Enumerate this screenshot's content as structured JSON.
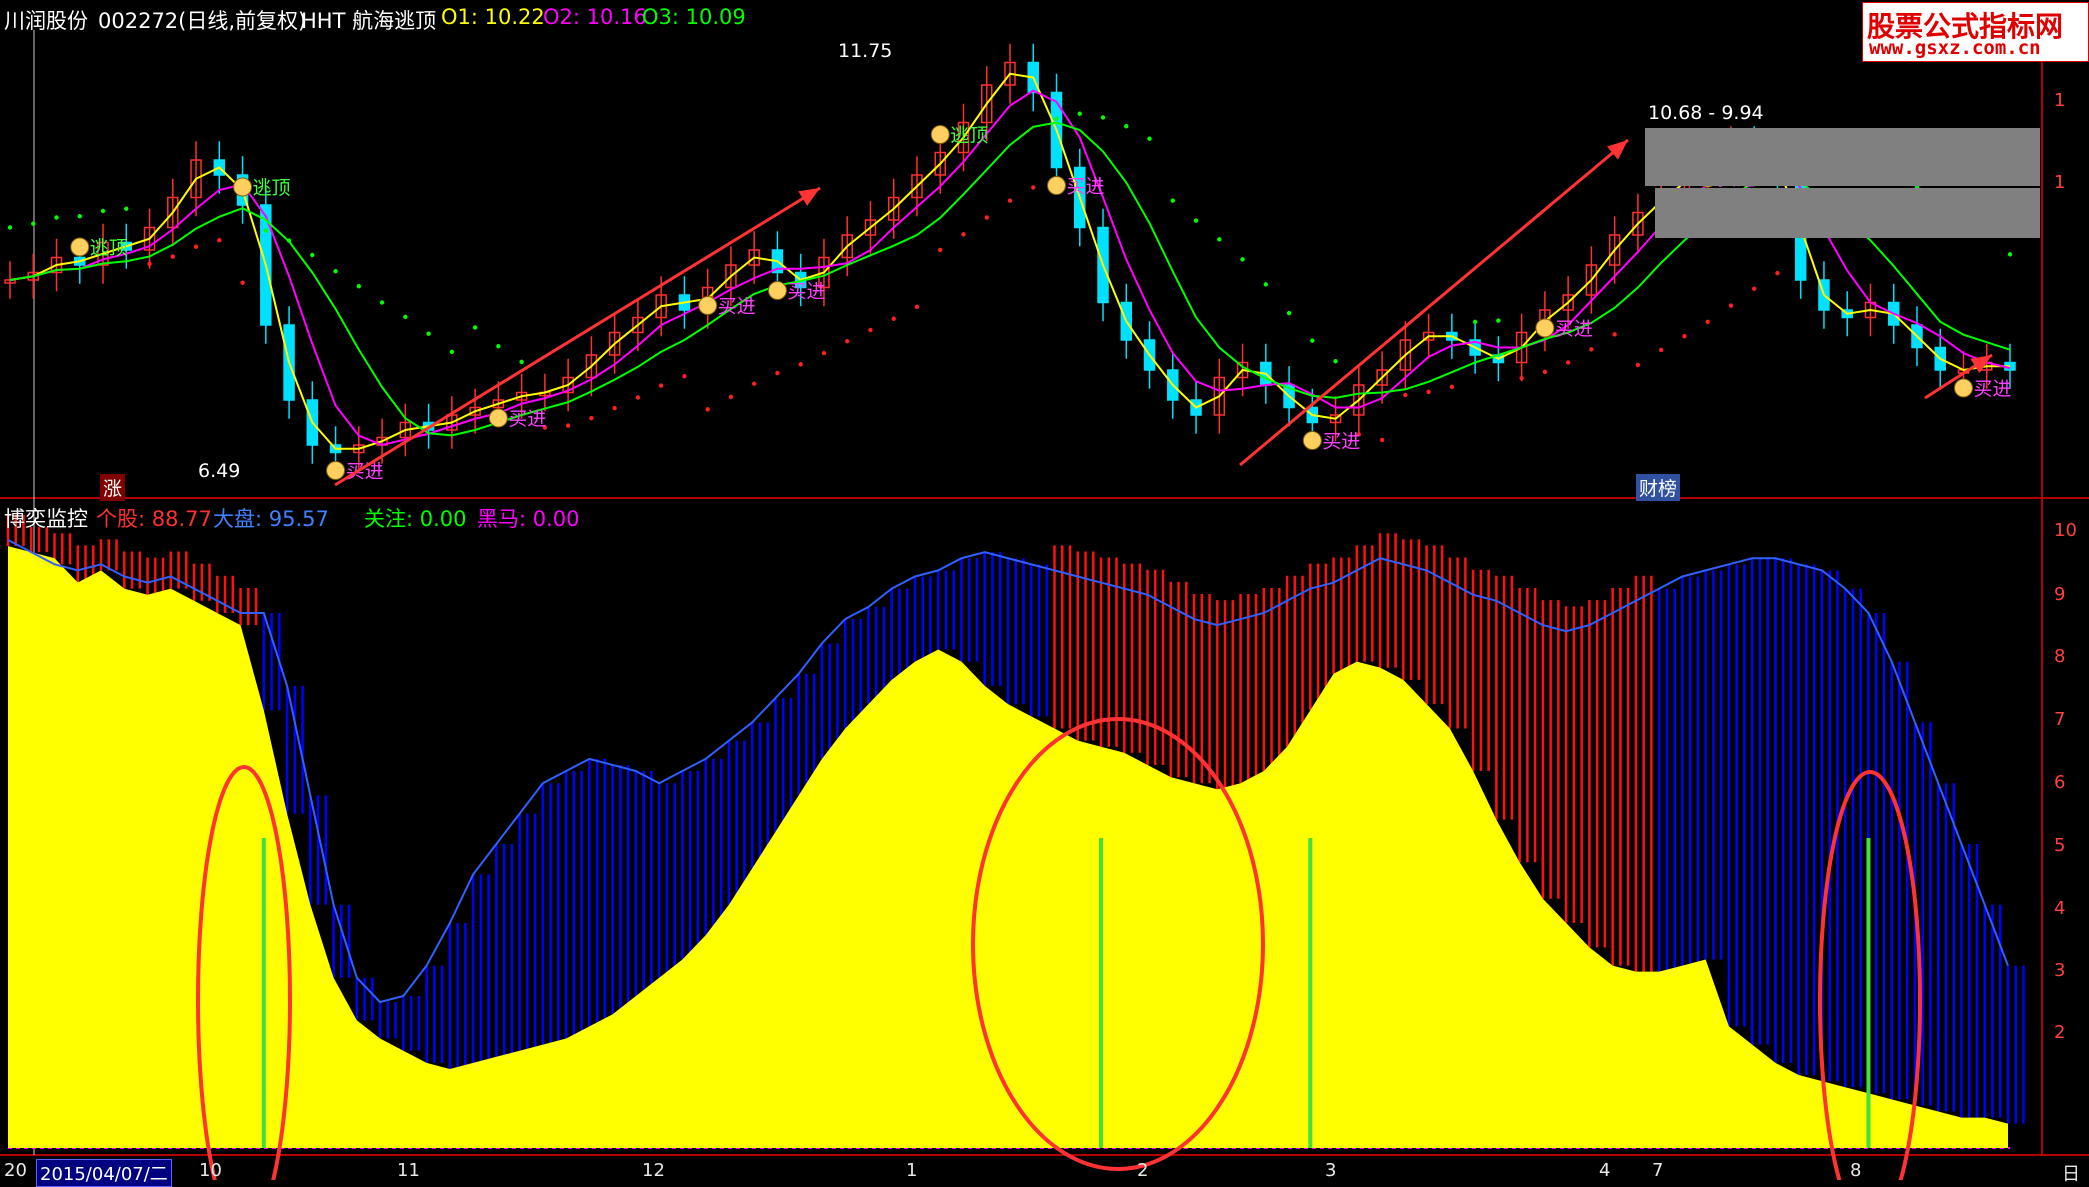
{
  "header": {
    "stock_name": "川润股份",
    "stock_code": "002272(日线,前复权)",
    "indicator_name": "HHT 航海逃顶",
    "o1_label": "O1: 10.22",
    "o2_label": "O2: 10.16",
    "o3_label": "O3: 10.09"
  },
  "watermark": {
    "title": "股票公式指标网",
    "url": "www.gsxz.com.cn"
  },
  "price_panel": {
    "high_label": "11.75",
    "low_label": "6.49",
    "range_label": "10.68 - 9.94",
    "top_label": "逃顶",
    "buy_label": "买进",
    "zhang_badge": "涨",
    "caibang_badge": "财榜"
  },
  "lower_panel": {
    "title": "博奕监控",
    "gegu_label": "个股: 88.77",
    "dapan_label": "大盘: 95.57",
    "guanzhu_label": "关注: 0.00",
    "heima_label": "黑马: 0.00",
    "y_ticks": [
      "10",
      "9",
      "8",
      "7",
      "6",
      "5",
      "4",
      "3",
      "2"
    ]
  },
  "price_y_ticks": [
    "1",
    "1",
    "",
    "",
    "",
    "",
    ""
  ],
  "x_axis": {
    "first_label": "20",
    "selected_date": "2015/04/07/二",
    "month_labels": [
      "10",
      "11",
      "12",
      "1",
      "2",
      "3",
      "4",
      "7",
      "8"
    ],
    "right_label": "日"
  },
  "colors": {
    "background": "#000000",
    "up": "#ff3030",
    "down": "#00e0ff",
    "ma_yellow": "#ffff00",
    "ma_magenta": "#ff00ff",
    "ma_green": "#00ff00",
    "gegu": "#ffff00",
    "dapan": "#0000ff",
    "red_bars": "#ff1010",
    "annotation_red": "#ff3333"
  },
  "chart_data": {
    "type": "line",
    "title": "川润股份 002272",
    "price_series": [
      8.8,
      8.9,
      9.1,
      9.0,
      9.3,
      9.2,
      9.5,
      9.9,
      10.4,
      10.2,
      9.8,
      8.2,
      7.2,
      6.6,
      6.5,
      6.6,
      6.7,
      6.9,
      6.8,
      7.0,
      7.1,
      7.2,
      7.3,
      7.3,
      7.5,
      7.8,
      8.1,
      8.3,
      8.6,
      8.4,
      8.7,
      9.0,
      9.2,
      8.9,
      8.7,
      9.1,
      9.4,
      9.6,
      9.9,
      10.2,
      10.5,
      10.9,
      11.4,
      11.7,
      11.3,
      10.3,
      9.5,
      8.5,
      8.0,
      7.6,
      7.2,
      7.0,
      7.5,
      7.7,
      7.4,
      7.1,
      6.9,
      7.0,
      7.4,
      7.6,
      8.0,
      8.1,
      8.0,
      7.8,
      7.7,
      8.1,
      8.4,
      8.6,
      9.0,
      9.4,
      9.7,
      10.0,
      10.2,
      10.4,
      10.6,
      10.5,
      10.2,
      8.8,
      8.4,
      8.3,
      8.5,
      8.2,
      7.9,
      7.6,
      7.6,
      7.7,
      7.6
    ],
    "series": [
      {
        "name": "个股",
        "values": [
          99,
          98,
          97,
          93,
          95,
          92,
          91,
          92,
          90,
          88,
          86,
          72,
          55,
          40,
          28,
          21,
          18,
          16,
          14,
          13,
          14,
          15,
          16,
          17,
          18,
          20,
          22,
          25,
          28,
          31,
          35,
          40,
          46,
          52,
          58,
          64,
          69,
          73,
          77,
          80,
          82,
          80,
          76,
          73,
          71,
          69,
          67,
          66,
          65,
          63,
          61,
          60,
          59,
          60,
          62,
          66,
          72,
          78,
          80,
          79,
          77,
          73,
          69,
          62,
          54,
          47,
          41,
          37,
          33,
          30,
          29,
          29,
          30,
          31,
          20,
          17,
          14,
          12,
          11,
          10,
          9,
          8,
          7,
          6,
          5,
          5,
          4
        ]
      },
      {
        "name": "大盘",
        "values": [
          100,
          98,
          96,
          95,
          96,
          94,
          93,
          94,
          92,
          90,
          88,
          88,
          76,
          58,
          40,
          28,
          24,
          25,
          30,
          37,
          45,
          50,
          55,
          60,
          62,
          64,
          63,
          62,
          60,
          62,
          64,
          67,
          70,
          74,
          78,
          83,
          87,
          89,
          92,
          94,
          95,
          97,
          98,
          97,
          96,
          95,
          94,
          93,
          92,
          91,
          89,
          87,
          86,
          87,
          88,
          90,
          92,
          93,
          95,
          97,
          96,
          95,
          93,
          91,
          90,
          88,
          86,
          85,
          86,
          88,
          90,
          92,
          94,
          95,
          96,
          97,
          97,
          96,
          95,
          92,
          88,
          80,
          70,
          60,
          50,
          40,
          30
        ]
      },
      {
        "name": "关注",
        "values": []
      },
      {
        "name": "黑马",
        "values": []
      }
    ],
    "ylim": [
      0,
      100
    ],
    "signal_indices": [
      11,
      47,
      56,
      80
    ]
  }
}
